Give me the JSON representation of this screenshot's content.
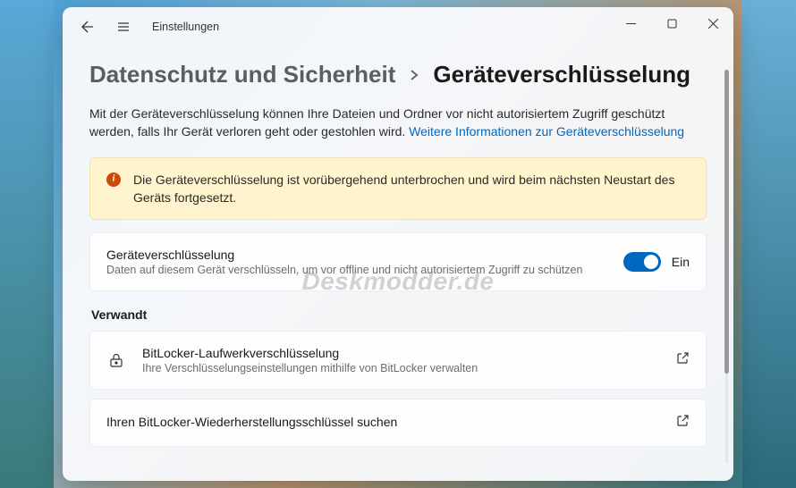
{
  "window": {
    "title": "Einstellungen"
  },
  "breadcrumb": {
    "parent": "Datenschutz und Sicherheit",
    "current": "Geräteverschlüsselung"
  },
  "description": {
    "text1": "Mit der Geräteverschlüsselung können Ihre Dateien und Ordner vor nicht autorisiertem Zugriff geschützt werden, falls Ihr Gerät verloren geht oder gestohlen wird. ",
    "link_text": "Weitere Informationen zur Geräteverschlüsselung"
  },
  "banner": {
    "text": "Die Geräteverschlüsselung ist vorübergehend unterbrochen und wird beim nächsten Neustart des Geräts fortgesetzt."
  },
  "encryption_card": {
    "title": "Geräteverschlüsselung",
    "subtitle": "Daten auf diesem Gerät verschlüsseln, um vor offline und nicht autorisiertem Zugriff zu schützen",
    "toggle_state": "Ein"
  },
  "related": {
    "header": "Verwandt",
    "bitlocker": {
      "title": "BitLocker-Laufwerkverschlüsselung",
      "subtitle": "Ihre Verschlüsselungseinstellungen mithilfe von BitLocker verwalten"
    },
    "recovery": {
      "title": "Ihren BitLocker-Wiederherstellungsschlüssel suchen"
    }
  },
  "watermark": "Deskmodder.de"
}
